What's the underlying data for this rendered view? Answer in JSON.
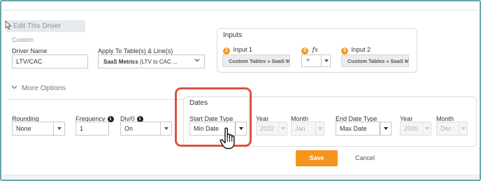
{
  "header": {
    "edit_title": "Edit This Driver",
    "subtitle": "Custom"
  },
  "driver": {
    "name_label": "Driver Name",
    "name_value": "LTV/CAC",
    "apply_label": "Apply To Table(s) & Line(s)",
    "apply_value_bold": "SaaS Metrics",
    "apply_value_rest": " (LTV to CAC ..."
  },
  "inputs": {
    "title": "Inputs",
    "input1": {
      "badge": "1",
      "label": "Input 1",
      "value": "Custom Tables » SaaS M..."
    },
    "operator": {
      "badge": "2",
      "label": "fx",
      "value": "÷"
    },
    "input2": {
      "badge": "3",
      "label": "Input 2",
      "value": "Custom Tables » SaaS M..."
    }
  },
  "more_options": {
    "label": "More Options",
    "chevron": "chevron-down-icon"
  },
  "options": {
    "rounding": {
      "label": "Rounding",
      "value": "None"
    },
    "frequency": {
      "label": "Frequency",
      "value": "1",
      "info": "i"
    },
    "div0": {
      "label": "Div/0",
      "value": "On",
      "info": "i"
    }
  },
  "dates": {
    "title": "Dates",
    "start_type": {
      "label": "Start Date Type",
      "value": "Min Date"
    },
    "start_year": {
      "label": "Year",
      "value": "2022"
    },
    "start_month": {
      "label": "Month",
      "value": "Jan"
    },
    "end_type": {
      "label": "End Date Type",
      "value": "Max Date"
    },
    "end_year": {
      "label": "Year",
      "value": "2026"
    },
    "end_month": {
      "label": "Month",
      "value": "Dec"
    }
  },
  "actions": {
    "save": "Save",
    "cancel": "Cancel"
  },
  "colors": {
    "accent": "#f7941d",
    "badge": "#f29a1e",
    "highlight": "#d7553f",
    "frame": "#6aa7a8"
  },
  "icons": {
    "cursor": "hand-pointer-icon",
    "pointer": "arrow-cursor-icon"
  }
}
